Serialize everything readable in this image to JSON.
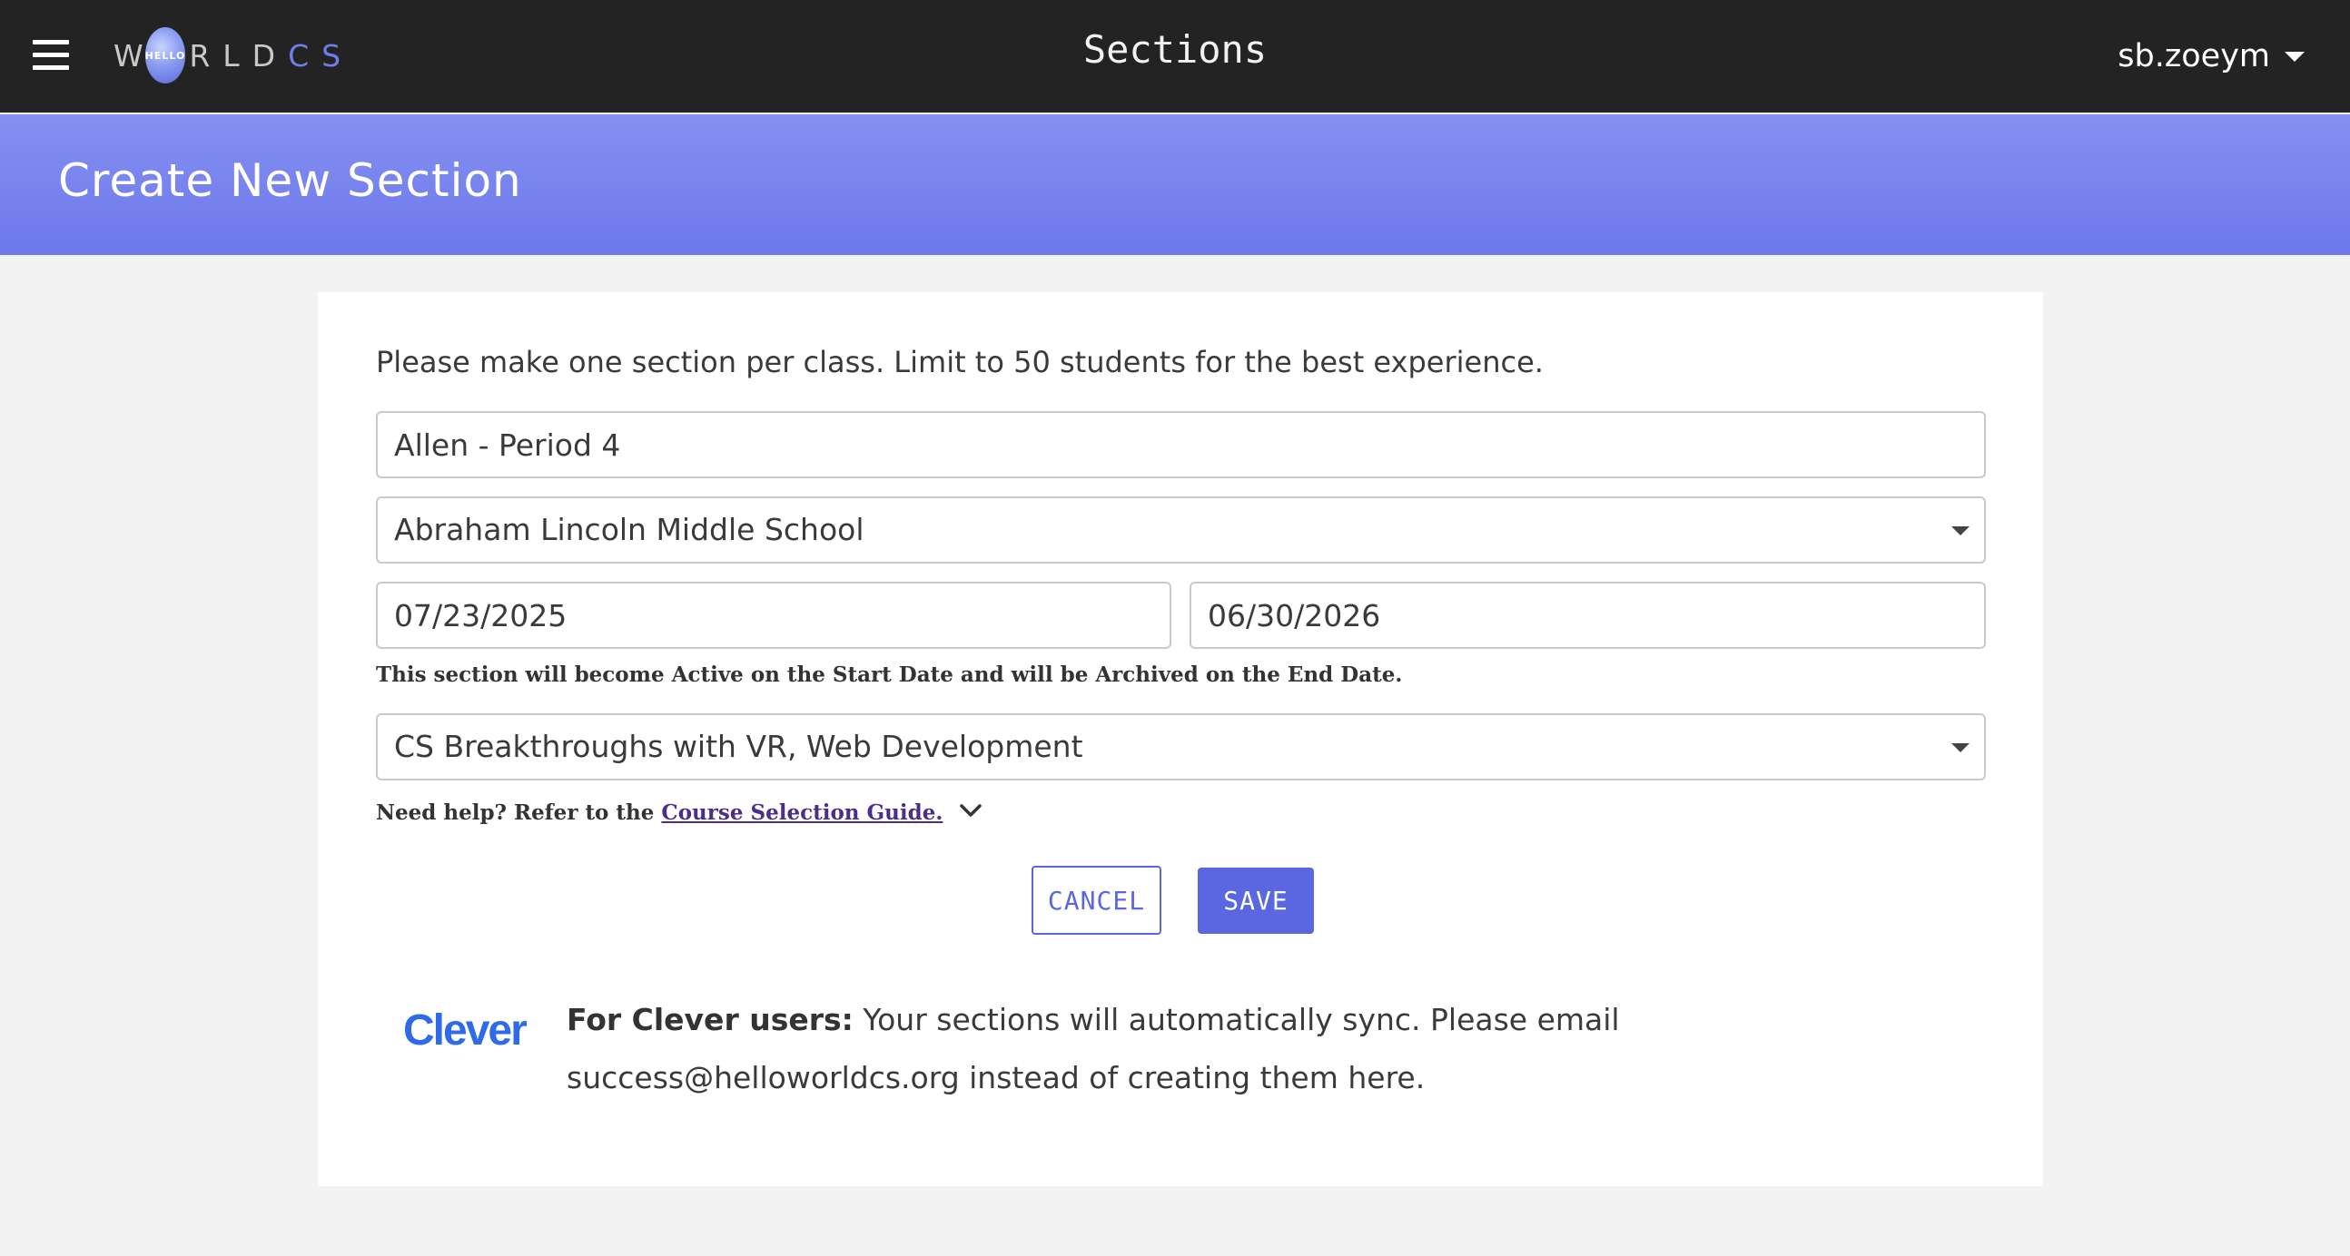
{
  "topbar": {
    "logo": {
      "w": "W",
      "globe": "HELLO",
      "rld": "RLD",
      "cs": "CS"
    },
    "page_title": "Sections",
    "username": "sb.zoeym"
  },
  "banner": {
    "title": "Create New Section"
  },
  "form": {
    "intro": "Please make one section per class. Limit to 50 students for the best experience.",
    "section_name": "Allen - Period 4",
    "school": "Abraham Lincoln Middle School",
    "start_date": "07/23/2025",
    "end_date": "06/30/2026",
    "date_note": "This section will become Active on the Start Date and will be Archived on the End Date.",
    "courses": "CS Breakthroughs with VR, Web Development",
    "help_prefix": "Need help? Refer to the ",
    "help_link": "Course Selection Guide.",
    "cancel_label": "CANCEL",
    "save_label": "SAVE"
  },
  "clever": {
    "logo": "Clever",
    "bold": "For Clever users:",
    "text": " Your sections will automatically sync. Please email success@helloworldcs.org instead of creating them here."
  },
  "colors": {
    "accent": "#5b67e0",
    "topbar": "#232323",
    "banner": "#7a85ee"
  },
  "icons": [
    "menu-icon",
    "chevron-down-icon",
    "caret-down-icon"
  ]
}
